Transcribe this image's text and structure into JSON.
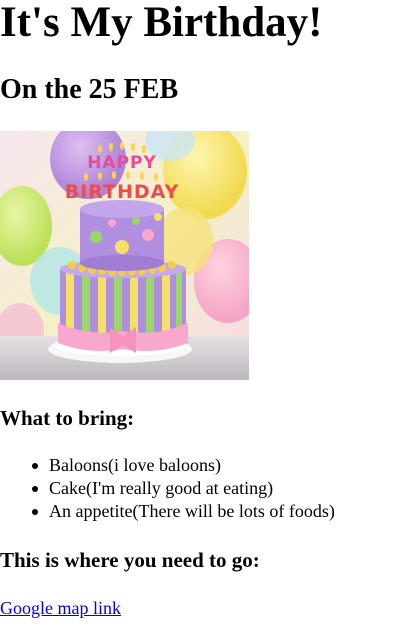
{
  "page": {
    "title": "It's My Birthday!",
    "date_line": "On the 25 FEB"
  },
  "image": {
    "subject": "birthday cake with candles spelling HAPPY BIRTHDAY and balloons",
    "candle_text": "HAPPY BIRTHDAY"
  },
  "bring": {
    "heading": "What to bring:",
    "items": [
      {
        "text": "Baloons(i love baloons)"
      },
      {
        "text": "Cake(I'm really good at eating)"
      },
      {
        "text": "An appetite(There will be lots of foods)"
      }
    ]
  },
  "location": {
    "heading": "This is where you need to go:",
    "link_text": "Google map link"
  },
  "colors": {
    "link": "#0000ee",
    "text": "#000000",
    "background": "#ffffff"
  }
}
